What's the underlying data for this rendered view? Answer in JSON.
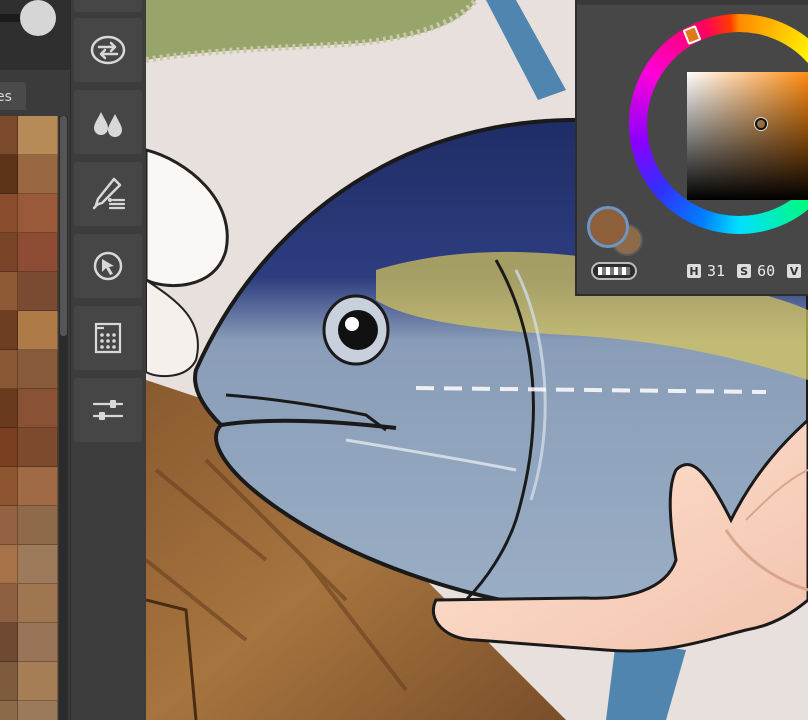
{
  "swatches_panel": {
    "tab_label": "es",
    "rows": [
      [
        "#7a4a2a",
        "#b78b58"
      ],
      [
        "#5e3418",
        "#9a6840"
      ],
      [
        "#8a4e2e",
        "#9a5a3a"
      ],
      [
        "#7a4428",
        "#8e4c34"
      ],
      [
        "#8e5a36",
        "#7a4a32"
      ],
      [
        "#6e3e22",
        "#ad7a48"
      ],
      [
        "#8a5834",
        "#875a3a"
      ],
      [
        "#6a3a1e",
        "#8a5234"
      ],
      [
        "#7a3e20",
        "#7e4a2e"
      ],
      [
        "#8e5630",
        "#a06a44"
      ],
      [
        "#946242",
        "#8e6a4a"
      ],
      [
        "#a87248",
        "#9c7a5a"
      ],
      [
        "#8c6040",
        "#a07650"
      ],
      [
        "#6e4a32",
        "#9a7458"
      ],
      [
        "#7e5a3e",
        "#a67e56"
      ],
      [
        "#8a6a48",
        "#9a7a5a"
      ]
    ]
  },
  "tools": [
    {
      "name": "transform-tool",
      "icon": "swap-arrows-icon"
    },
    {
      "name": "blend-tool",
      "icon": "water-drops-icon"
    },
    {
      "name": "brush-settings-tool",
      "icon": "brush-menu-icon"
    },
    {
      "name": "select-tool",
      "icon": "cursor-circle-icon"
    },
    {
      "name": "grid-tool",
      "icon": "dot-grid-icon"
    },
    {
      "name": "adjustments-tool",
      "icon": "sliders-icon"
    }
  ],
  "color_panel": {
    "title": "",
    "hsv": {
      "h_label": "H",
      "h_value": "31",
      "s_label": "S",
      "s_value": "60",
      "v_label": "V"
    },
    "primary_color": "#8d5f3b",
    "secondary_color": "#8d6a48",
    "hue_color": "#ff8400"
  }
}
